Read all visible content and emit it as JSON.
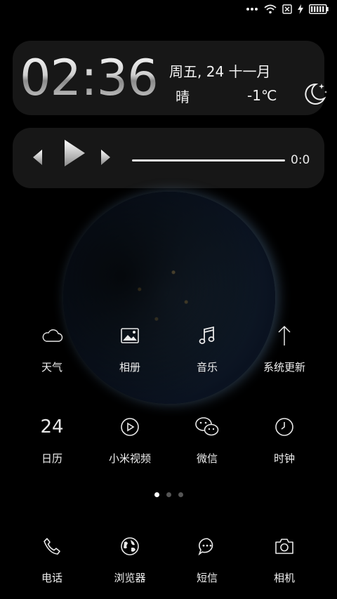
{
  "status_bar": {
    "icons": [
      "dots-icon",
      "wifi-icon",
      "no-sim-icon",
      "charging-icon",
      "battery-icon"
    ],
    "battery_level": 1.0
  },
  "clock_widget": {
    "time": "02:36",
    "date": "周五, 24 十一月",
    "weather": "晴",
    "temperature": "-1℃",
    "weather_icon": "moon-stars-icon"
  },
  "music_widget": {
    "elapsed": "0:0",
    "progress": 0,
    "controls": [
      "previous",
      "play",
      "next"
    ]
  },
  "apps_page": [
    {
      "label": "天气",
      "icon": "cloud-icon"
    },
    {
      "label": "相册",
      "icon": "photo-icon"
    },
    {
      "label": "音乐",
      "icon": "music-note-icon"
    },
    {
      "label": "系统更新",
      "icon": "arrow-up-icon"
    },
    {
      "label": "日历",
      "icon": "calendar-icon",
      "icon_text": "24"
    },
    {
      "label": "小米视频",
      "icon": "play-circle-icon"
    },
    {
      "label": "微信",
      "icon": "wechat-icon"
    },
    {
      "label": "时钟",
      "icon": "clock-icon"
    }
  ],
  "page_indicator": {
    "pages": 3,
    "current": 1
  },
  "dock": [
    {
      "label": "电话",
      "icon": "phone-icon"
    },
    {
      "label": "浏览器",
      "icon": "globe-icon"
    },
    {
      "label": "短信",
      "icon": "message-icon"
    },
    {
      "label": "相机",
      "icon": "camera-icon"
    }
  ]
}
